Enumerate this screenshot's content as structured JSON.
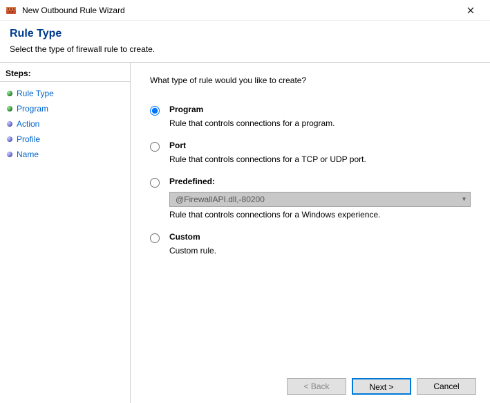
{
  "window": {
    "title": "New Outbound Rule Wizard"
  },
  "header": {
    "title": "Rule Type",
    "subtitle": "Select the type of firewall rule to create."
  },
  "sidebar": {
    "header": "Steps:",
    "items": [
      {
        "label": "Rule Type"
      },
      {
        "label": "Program"
      },
      {
        "label": "Action"
      },
      {
        "label": "Profile"
      },
      {
        "label": "Name"
      }
    ]
  },
  "main": {
    "question": "What type of rule would you like to create?",
    "options": {
      "program": {
        "label": "Program",
        "desc": "Rule that controls connections for a program."
      },
      "port": {
        "label": "Port",
        "desc": "Rule that controls connections for a TCP or UDP port."
      },
      "predefined": {
        "label": "Predefined:",
        "combo_value": "@FirewallAPI.dll,-80200",
        "desc": "Rule that controls connections for a Windows experience."
      },
      "custom": {
        "label": "Custom",
        "desc": "Custom rule."
      }
    }
  },
  "footer": {
    "back": "< Back",
    "next": "Next >",
    "cancel": "Cancel"
  }
}
